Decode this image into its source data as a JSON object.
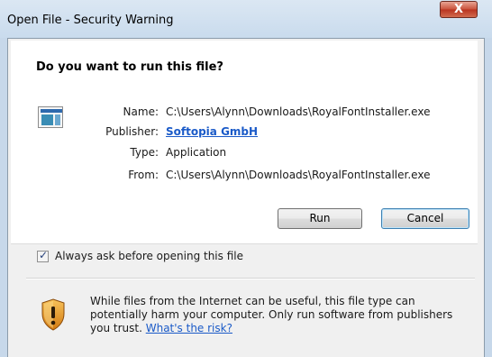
{
  "window": {
    "title": "Open File - Security Warning",
    "close_glyph": "X"
  },
  "question": "Do you want to run this file?",
  "fields": {
    "name_label": "Name:",
    "name_value": "C:\\Users\\Alynn\\Downloads\\RoyalFontInstaller.exe",
    "publisher_label": "Publisher:",
    "publisher_value": "Softopia GmbH",
    "type_label": "Type:",
    "type_value": "Application",
    "from_label": "From:",
    "from_value": "C:\\Users\\Alynn\\Downloads\\RoyalFontInstaller.exe"
  },
  "buttons": {
    "run": "Run",
    "cancel": "Cancel"
  },
  "always_ask": {
    "label": "Always ask before opening this file",
    "checked": true
  },
  "warning": {
    "text": "While files from the Internet can be useful, this file type can potentially harm your computer. Only run software from publishers you trust.",
    "link": "What's the risk?"
  },
  "icons": {
    "file": "application-file-icon",
    "warning": "security-shield-warning-icon"
  }
}
